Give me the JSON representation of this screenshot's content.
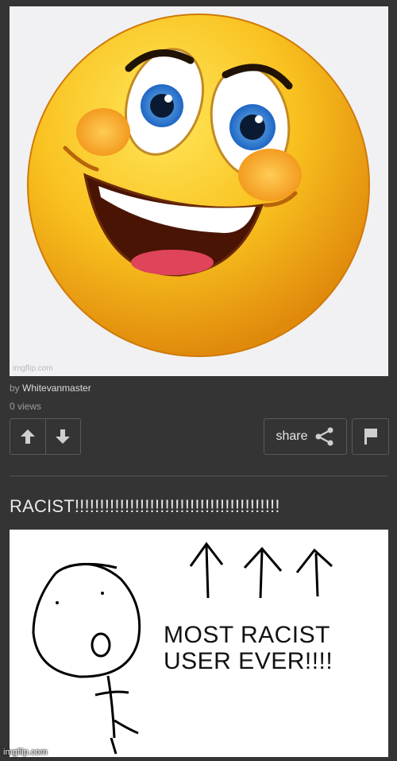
{
  "post": {
    "watermark": "imgflip.com",
    "by_prefix": "by",
    "author": "Whitevanmaster",
    "views": "0 views",
    "share_label": "share"
  },
  "comment": {
    "text": "RACIST!!!!!!!!!!!!!!!!!!!!!!!!!!!!!!!!!!!!!!!!!"
  },
  "comment_image": {
    "caption_line1": "MOST RACIST",
    "caption_line2": "USER EVER!!!!",
    "watermark": "imgflip.com"
  },
  "icons": {
    "upvote": "arrow-up-icon",
    "downvote": "arrow-down-icon",
    "share": "share-icon",
    "flag": "flag-icon"
  },
  "colors": {
    "background": "#343434",
    "emoji_yellow": "#f7b91c",
    "button_border": "#5a5a5a"
  }
}
